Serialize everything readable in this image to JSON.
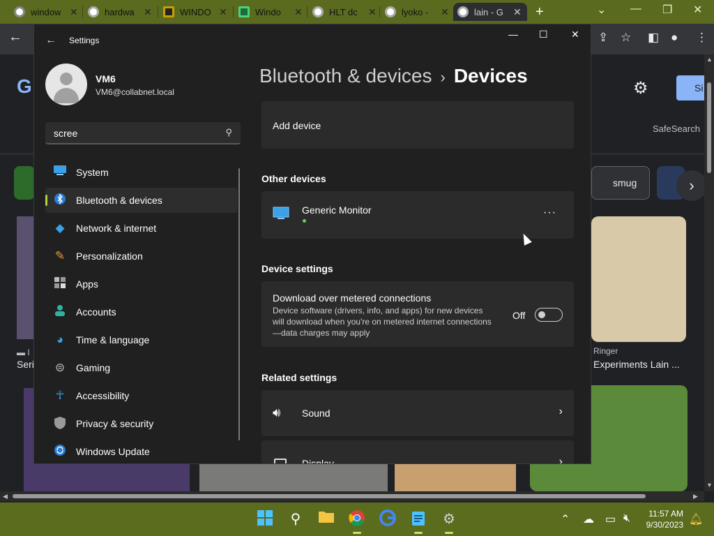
{
  "browser": {
    "tabs": [
      {
        "title": "window"
      },
      {
        "title": "hardwa"
      },
      {
        "title": "WINDO"
      },
      {
        "title": "Windo"
      },
      {
        "title": "HLT dc"
      },
      {
        "title": "lyoko -"
      },
      {
        "title": "lain - G"
      }
    ],
    "new_tab": "+"
  },
  "google": {
    "logo": "G",
    "sign_in": "Si",
    "safesearch": "SafeSearch",
    "chip_smug": "smug",
    "caption_ringer": "Ringer",
    "title_experiments": "Experiments Lain ...",
    "caption_left": "Seri"
  },
  "settings": {
    "app_title": "Settings",
    "user": {
      "name": "VM6",
      "email": "VM6@collabnet.local"
    },
    "search": {
      "value": "scree"
    },
    "nav": [
      {
        "label": "System",
        "icon": "monitor-icon"
      },
      {
        "label": "Bluetooth & devices",
        "icon": "bluetooth-icon",
        "selected": true
      },
      {
        "label": "Network & internet",
        "icon": "wifi-icon"
      },
      {
        "label": "Personalization",
        "icon": "brush-icon"
      },
      {
        "label": "Apps",
        "icon": "apps-icon"
      },
      {
        "label": "Accounts",
        "icon": "person-icon"
      },
      {
        "label": "Time & language",
        "icon": "clock-globe-icon"
      },
      {
        "label": "Gaming",
        "icon": "gamepad-icon"
      },
      {
        "label": "Accessibility",
        "icon": "accessibility-icon"
      },
      {
        "label": "Privacy & security",
        "icon": "shield-icon"
      },
      {
        "label": "Windows Update",
        "icon": "update-icon"
      }
    ],
    "breadcrumb": {
      "parent": "Bluetooth & devices",
      "separator": "›",
      "current": "Devices"
    },
    "add_device": "Add device",
    "other_devices_header": "Other devices",
    "generic_monitor": "Generic Monitor",
    "device_settings_header": "Device settings",
    "metered": {
      "title": "Download over metered connections",
      "description": "Device software (drivers, info, and apps) for new devices will download when you're on metered internet connections—data charges may apply",
      "state": "Off"
    },
    "related_header": "Related settings",
    "sound": "Sound",
    "display": "Display"
  },
  "taskbar": {
    "time": "11:57 AM",
    "date": "9/30/2023"
  },
  "colors": {
    "accent": "#b2d236",
    "taskbar": "#5b6c1f",
    "tabstrip": "#5a6b1f"
  }
}
